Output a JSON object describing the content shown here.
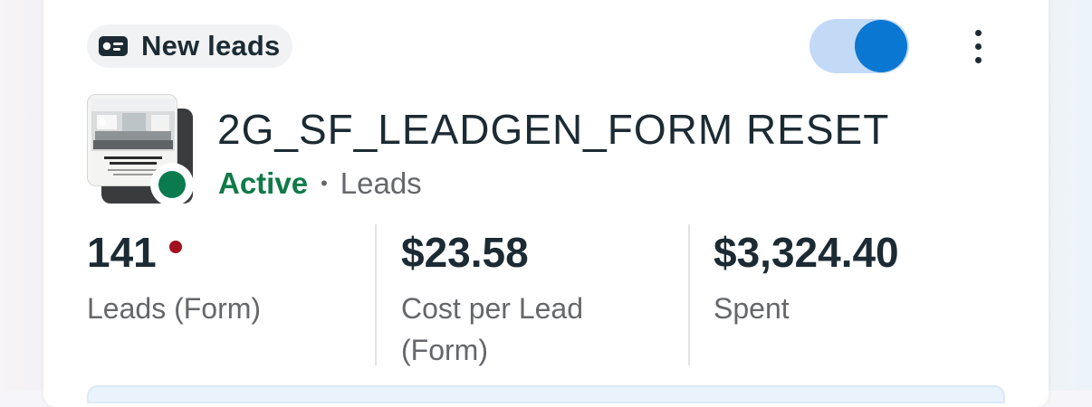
{
  "card": {
    "objective": {
      "icon": "lead-form-icon",
      "label": "New leads"
    },
    "toggle": {
      "state": "on",
      "color_on": "#0a78d2",
      "track_on": "#c3daf6"
    },
    "more_menu": {
      "icon": "more-vertical-icon"
    },
    "ad": {
      "name": "2G_SF_LEADGEN_FORM RESET",
      "status": "Active",
      "status_color": "#0f7a48",
      "separator": "•",
      "type": "Leads",
      "thumbnail": "kitchen-remodel-ad-thumbnail"
    },
    "metrics": [
      {
        "value": "141",
        "label": "Leads (Form)",
        "alert": true,
        "alert_color": "#a3111e"
      },
      {
        "value": "$23.58",
        "label": "Cost per Lead (Form)"
      },
      {
        "value": "$3,324.40",
        "label": "Spent"
      }
    ]
  }
}
